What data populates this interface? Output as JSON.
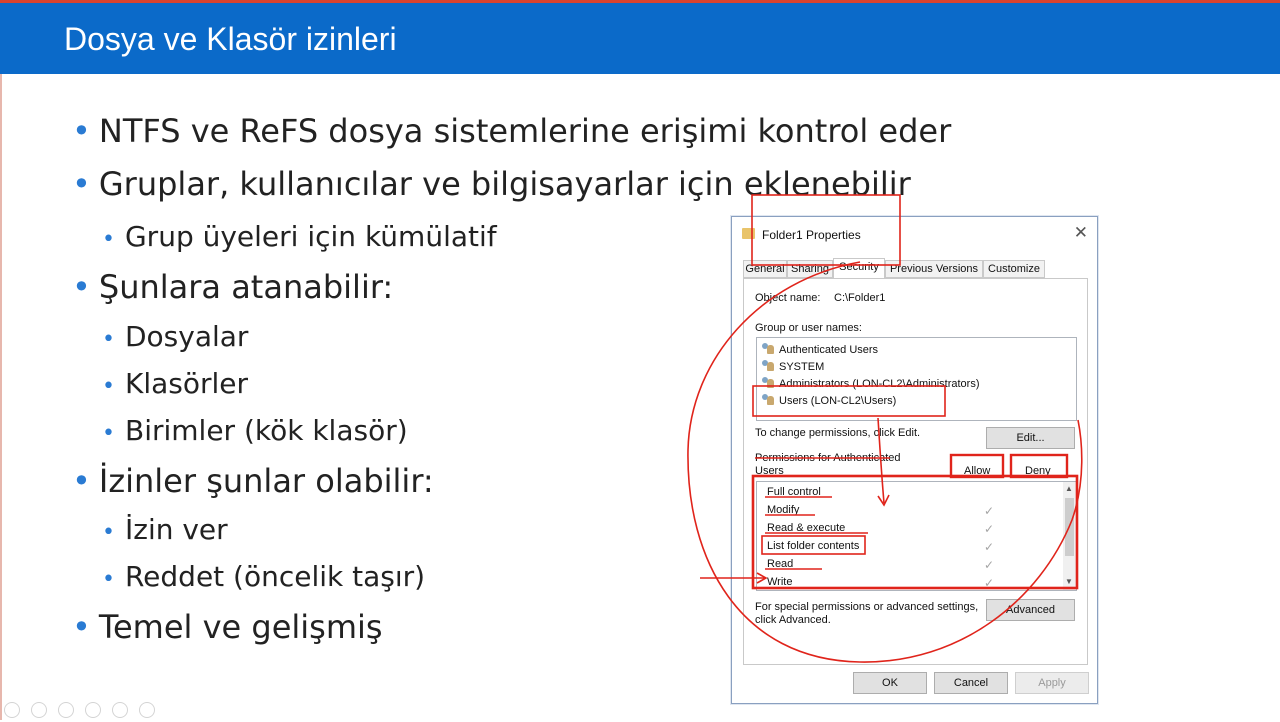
{
  "slide": {
    "title": "Dosya ve Klasör izinleri",
    "bullets": [
      {
        "level": 1,
        "text": "NTFS ve ReFS dosya sistemlerine erişimi kontrol eder"
      },
      {
        "level": 1,
        "text": "Gruplar, kullanıcılar ve bilgisayarlar için eklenebilir"
      },
      {
        "level": 2,
        "text": "Grup üyeleri için kümülatif"
      },
      {
        "level": 1,
        "text": "Şunlara atanabilir:"
      },
      {
        "level": 2,
        "text": "Dosyalar"
      },
      {
        "level": 2,
        "text": "Klasörler"
      },
      {
        "level": 2,
        "text": "Birimler (kök klasör)"
      },
      {
        "level": 1,
        "text": "İzinler şunlar olabilir:"
      },
      {
        "level": 2,
        "text": "İzin ver"
      },
      {
        "level": 2,
        "text": "Reddet (öncelik taşır)"
      },
      {
        "level": 1,
        "text": "Temel ve gelişmiş"
      }
    ],
    "bullet_symbol": "•",
    "colors": {
      "title_bar": "#0b6ac9",
      "accent_line": "#d9432f",
      "bullet": "#2a7bd3",
      "annotation": "#e0241b"
    }
  },
  "dialog": {
    "title": "Folder1 Properties",
    "close_symbol": "✕",
    "tabs": [
      "General",
      "Sharing",
      "Security",
      "Previous Versions",
      "Customize"
    ],
    "active_tab": "Security",
    "object_name_label": "Object name:",
    "object_name_value": "C:\\Folder1",
    "group_label": "Group or user names:",
    "users": [
      "Authenticated Users",
      "SYSTEM",
      "Administrators (LON-CL2\\Administrators)",
      "Users (LON-CL2\\Users)"
    ],
    "change_text": "To change permissions, click Edit.",
    "edit_button": "Edit...",
    "perm_label_line1": "Permissions for Authenticated",
    "perm_label_line2": "Users",
    "allow_header": "Allow",
    "deny_header": "Deny",
    "permissions": [
      {
        "name": "Full control",
        "allow": ""
      },
      {
        "name": "Modify",
        "allow": "✓"
      },
      {
        "name": "Read & execute",
        "allow": "✓"
      },
      {
        "name": "List folder contents",
        "allow": "✓"
      },
      {
        "name": "Read",
        "allow": "✓"
      },
      {
        "name": "Write",
        "allow": "✓"
      }
    ],
    "scroll_up": "▲",
    "scroll_down": "▼",
    "special_line1": "For special permissions or advanced settings,",
    "special_line2": "click Advanced.",
    "advanced_button": "Advanced",
    "ok_button": "OK",
    "cancel_button": "Cancel",
    "apply_button": "Apply"
  }
}
